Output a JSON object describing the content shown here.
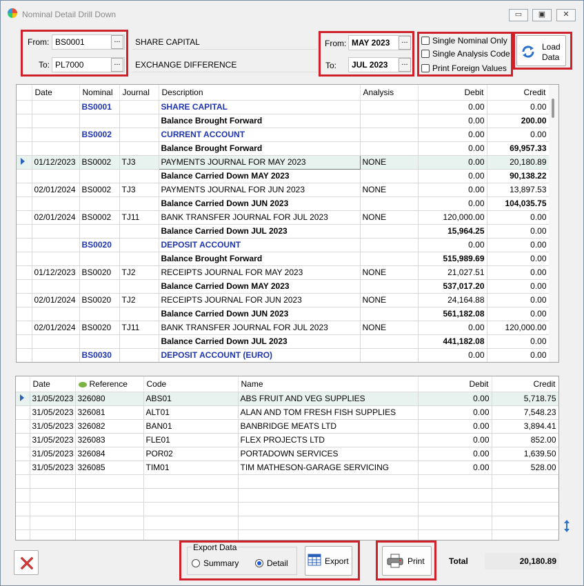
{
  "window": {
    "title": "Nominal Detail Drill Down"
  },
  "filters": {
    "from_label": "From:",
    "to_label": "To:",
    "from_nominal": "BS0001",
    "to_nominal": "PL7000",
    "from_desc": "SHARE CAPITAL",
    "to_desc": "EXCHANGE DIFFERENCE",
    "from_period": "MAY 2023",
    "to_period": "JUL 2023",
    "ellipsis": "..."
  },
  "options": {
    "single_nominal": "Single Nominal Only",
    "single_analysis": "Single Analysis Code",
    "print_foreign": "Print Foreign Values"
  },
  "load_button": {
    "line1": "Load",
    "line2": "Data"
  },
  "top_grid": {
    "columns": [
      "Date",
      "Nominal",
      "Journal",
      "Description",
      "Analysis",
      "Debit",
      "Credit"
    ],
    "rows": [
      {
        "date": "",
        "nominal": "BS0001",
        "journal": "",
        "description": "SHARE CAPITAL",
        "analysis": "",
        "debit": "0.00",
        "credit": "0.00",
        "style": "header"
      },
      {
        "date": "",
        "nominal": "",
        "journal": "",
        "description": "Balance Brought Forward",
        "analysis": "",
        "debit": "0.00",
        "credit": "200.00",
        "style": "bal",
        "bold_credit": true
      },
      {
        "date": "",
        "nominal": "BS0002",
        "journal": "",
        "description": "CURRENT ACCOUNT",
        "analysis": "",
        "debit": "0.00",
        "credit": "0.00",
        "style": "header"
      },
      {
        "date": "",
        "nominal": "",
        "journal": "",
        "description": "Balance Brought Forward",
        "analysis": "",
        "debit": "0.00",
        "credit": "69,957.33",
        "style": "bal",
        "bold_credit": true
      },
      {
        "date": "01/12/2023",
        "nominal": "BS0002",
        "journal": "TJ3",
        "description": "PAYMENTS JOURNAL FOR MAY 2023",
        "analysis": "NONE",
        "debit": "0.00",
        "credit": "20,180.89",
        "style": "sel"
      },
      {
        "date": "",
        "nominal": "",
        "journal": "",
        "description": "Balance Carried Down MAY 2023",
        "analysis": "",
        "debit": "0.00",
        "credit": "90,138.22",
        "style": "bal",
        "bold_credit": true
      },
      {
        "date": "02/01/2024",
        "nominal": "BS0002",
        "journal": "TJ3",
        "description": "PAYMENTS JOURNAL FOR JUN 2023",
        "analysis": "NONE",
        "debit": "0.00",
        "credit": "13,897.53",
        "style": "normal"
      },
      {
        "date": "",
        "nominal": "",
        "journal": "",
        "description": "Balance Carried Down JUN 2023",
        "analysis": "",
        "debit": "0.00",
        "credit": "104,035.75",
        "style": "bal",
        "bold_credit": true
      },
      {
        "date": "02/01/2024",
        "nominal": "BS0002",
        "journal": "TJ11",
        "description": "BANK TRANSFER JOURNAL FOR JUL 2023",
        "analysis": "NONE",
        "debit": "120,000.00",
        "credit": "0.00",
        "style": "normal"
      },
      {
        "date": "",
        "nominal": "",
        "journal": "",
        "description": "Balance Carried Down JUL 2023",
        "analysis": "",
        "debit": "15,964.25",
        "credit": "0.00",
        "style": "bal",
        "bold_debit": true
      },
      {
        "date": "",
        "nominal": "BS0020",
        "journal": "",
        "description": "DEPOSIT ACCOUNT",
        "analysis": "",
        "debit": "0.00",
        "credit": "0.00",
        "style": "header"
      },
      {
        "date": "",
        "nominal": "",
        "journal": "",
        "description": "Balance Brought Forward",
        "analysis": "",
        "debit": "515,989.69",
        "credit": "0.00",
        "style": "bal",
        "bold_debit": true
      },
      {
        "date": "01/12/2023",
        "nominal": "BS0020",
        "journal": "TJ2",
        "description": "RECEIPTS JOURNAL FOR MAY 2023",
        "analysis": "NONE",
        "debit": "21,027.51",
        "credit": "0.00",
        "style": "normal"
      },
      {
        "date": "",
        "nominal": "",
        "journal": "",
        "description": "Balance Carried Down MAY 2023",
        "analysis": "",
        "debit": "537,017.20",
        "credit": "0.00",
        "style": "bal",
        "bold_debit": true
      },
      {
        "date": "02/01/2024",
        "nominal": "BS0020",
        "journal": "TJ2",
        "description": "RECEIPTS JOURNAL FOR JUN 2023",
        "analysis": "NONE",
        "debit": "24,164.88",
        "credit": "0.00",
        "style": "normal"
      },
      {
        "date": "",
        "nominal": "",
        "journal": "",
        "description": "Balance Carried Down JUN 2023",
        "analysis": "",
        "debit": "561,182.08",
        "credit": "0.00",
        "style": "bal",
        "bold_debit": true
      },
      {
        "date": "02/01/2024",
        "nominal": "BS0020",
        "journal": "TJ11",
        "description": "BANK TRANSFER JOURNAL FOR JUL 2023",
        "analysis": "NONE",
        "debit": "0.00",
        "credit": "120,000.00",
        "style": "normal"
      },
      {
        "date": "",
        "nominal": "",
        "journal": "",
        "description": "Balance Carried Down JUL 2023",
        "analysis": "",
        "debit": "441,182.08",
        "credit": "0.00",
        "style": "bal",
        "bold_debit": true
      },
      {
        "date": "",
        "nominal": "BS0030",
        "journal": "",
        "description": "DEPOSIT ACCOUNT (EURO)",
        "analysis": "",
        "debit": "0.00",
        "credit": "0.00",
        "style": "header"
      }
    ]
  },
  "bottom_grid": {
    "columns": [
      "Date",
      "Reference",
      "Code",
      "Name",
      "Debit",
      "Credit"
    ],
    "rows": [
      {
        "date": "31/05/2023",
        "reference": "326080",
        "code": "ABS01",
        "name": "ABS  FRUIT AND VEG SUPPLIES",
        "debit": "0.00",
        "credit": "5,718.75"
      },
      {
        "date": "31/05/2023",
        "reference": "326081",
        "code": "ALT01",
        "name": "ALAN AND TOM FRESH FISH SUPPLIES",
        "debit": "0.00",
        "credit": "7,548.23"
      },
      {
        "date": "31/05/2023",
        "reference": "326082",
        "code": "BAN01",
        "name": "BANBRIDGE MEATS LTD",
        "debit": "0.00",
        "credit": "3,894.41"
      },
      {
        "date": "31/05/2023",
        "reference": "326083",
        "code": "FLE01",
        "name": "FLEX PROJECTS LTD",
        "debit": "0.00",
        "credit": "852.00"
      },
      {
        "date": "31/05/2023",
        "reference": "326084",
        "code": "POR02",
        "name": "PORTADOWN SERVICES",
        "debit": "0.00",
        "credit": "1,639.50"
      },
      {
        "date": "31/05/2023",
        "reference": "326085",
        "code": "TIM01",
        "name": "TIM MATHESON-GARAGE SERVICING",
        "debit": "0.00",
        "credit": "528.00"
      }
    ],
    "empty_rows": 5
  },
  "export": {
    "group_label": "Export Data",
    "summary": "Summary",
    "detail": "Detail",
    "selected": "detail",
    "button": "Export"
  },
  "print_button": "Print",
  "total": {
    "label": "Total",
    "value": "20,180.89"
  },
  "icons": [
    "app-icon",
    "minimize-icon",
    "maximize-icon",
    "close-icon",
    "refresh-icon",
    "printer-icon",
    "export-grid-icon",
    "cancel-x-icon",
    "resize-arrows-icon",
    "reference-sort-icon"
  ],
  "colors": {
    "highlight": "#d0202a",
    "nominal_header": "#1f35b0",
    "selected_row": "#e8f2ee",
    "row_indicator": "#2a61b8"
  }
}
